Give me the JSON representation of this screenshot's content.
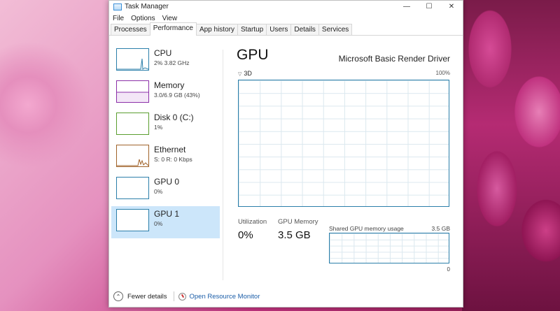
{
  "window": {
    "title": "Task Manager"
  },
  "controls": {
    "minimize": "—",
    "maximize": "☐",
    "close": "✕"
  },
  "menu": [
    "File",
    "Options",
    "View"
  ],
  "tabs": [
    "Processes",
    "Performance",
    "App history",
    "Startup",
    "Users",
    "Details",
    "Services"
  ],
  "active_tab": "Performance",
  "sidebar": {
    "items": [
      {
        "name": "CPU",
        "detail": "2% 3.82 GHz",
        "color": "#2b7faa"
      },
      {
        "name": "Memory",
        "detail": "3.0/6.9 GB (43%)",
        "color": "#8b2fa8"
      },
      {
        "name": "Disk 0 (C:)",
        "detail": "1%",
        "color": "#5a9e2f"
      },
      {
        "name": "Ethernet",
        "detail": "S: 0 R: 0 Kbps",
        "color": "#a0632a"
      },
      {
        "name": "GPU 0",
        "detail": "0%",
        "color": "#2b7faa"
      },
      {
        "name": "GPU 1",
        "detail": "0%",
        "color": "#2b7faa"
      }
    ],
    "selected_index": 5
  },
  "main": {
    "title": "GPU",
    "device": "Microsoft Basic Render Driver",
    "engine_label": "3D",
    "graph_max": "100%",
    "stats": {
      "utilization_label": "Utilization",
      "utilization_value": "0%",
      "memory_label": "GPU Memory",
      "memory_value": "3.5 GB"
    },
    "shared": {
      "label": "Shared GPU memory usage",
      "max": "3.5 GB",
      "min": "0"
    }
  },
  "footer": {
    "fewer_details": "Fewer details",
    "resource_monitor": "Open Resource Monitor"
  }
}
